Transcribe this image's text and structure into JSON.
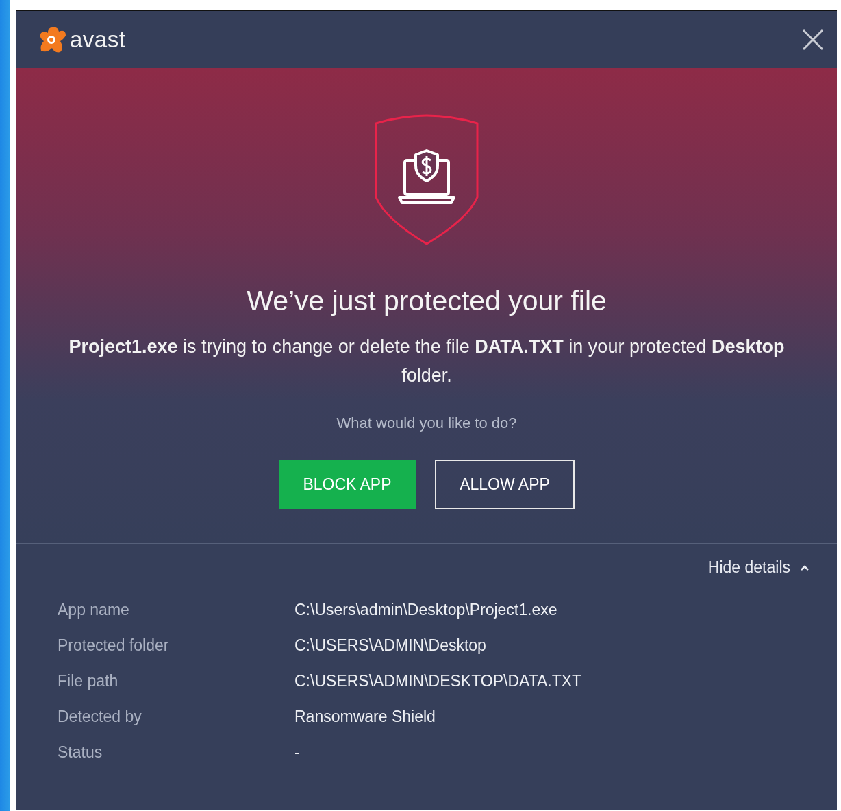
{
  "window": {
    "logo_text": "avast"
  },
  "alert": {
    "title": "We’ve just protected your file",
    "message": "**Project1.exe** is trying to change or delete the file **DATA.TXT** in your protected **Desktop** folder.",
    "question": "What would you like to do?"
  },
  "buttons": [
    {
      "label": "BLOCK APP",
      "kind": "primary"
    },
    {
      "label": "ALLOW APP",
      "kind": "outline"
    }
  ],
  "details": {
    "toggle_label": "Hide details",
    "expanded": true,
    "rows": [
      {
        "label": "App name",
        "value": "C:\\Users\\admin\\Desktop\\Project1.exe"
      },
      {
        "label": "Protected folder",
        "value": "C:\\USERS\\ADMIN\\Desktop"
      },
      {
        "label": "File path",
        "value": "C:\\USERS\\ADMIN\\DESKTOP\\DATA.TXT"
      },
      {
        "label": "Detected by",
        "value": "Ransomware Shield"
      },
      {
        "label": "Status",
        "value": "-"
      }
    ]
  }
}
